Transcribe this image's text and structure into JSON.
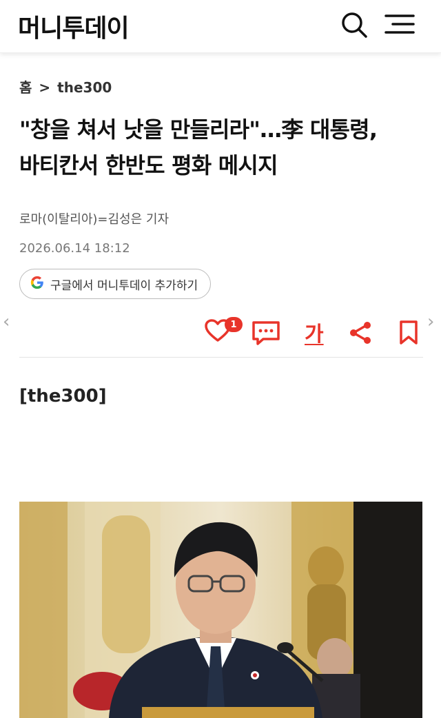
{
  "header": {
    "logo": "머니투데이",
    "search_icon": "search-icon",
    "menu_icon": "hamburger-menu-icon"
  },
  "breadcrumb": {
    "home": "홈",
    "separator": ">",
    "section": "the300"
  },
  "article": {
    "headline_line1": "\"창을 쳐서 낫을 만들리라\"…李 대통령,",
    "headline_line2": "바티칸서 한반도 평화 메시지",
    "byline": "로마(이탈리아)=김성은 기자",
    "timestamp": "2026.06.14 18:12",
    "section_tag": "[the300]"
  },
  "google_follow": {
    "label": "구글에서 머니투데이 추가하기",
    "icon": "google-g-icon"
  },
  "actions": {
    "like_icon": "heart-icon",
    "like_count": "1",
    "comment_icon": "comment-icon",
    "font_size_label": "가",
    "share_icon": "share-icon",
    "bookmark_icon": "bookmark-icon"
  },
  "nav": {
    "prev": "‹",
    "next": "›"
  },
  "colors": {
    "accent": "#e8342a",
    "text": "#111111",
    "muted": "#777777"
  }
}
